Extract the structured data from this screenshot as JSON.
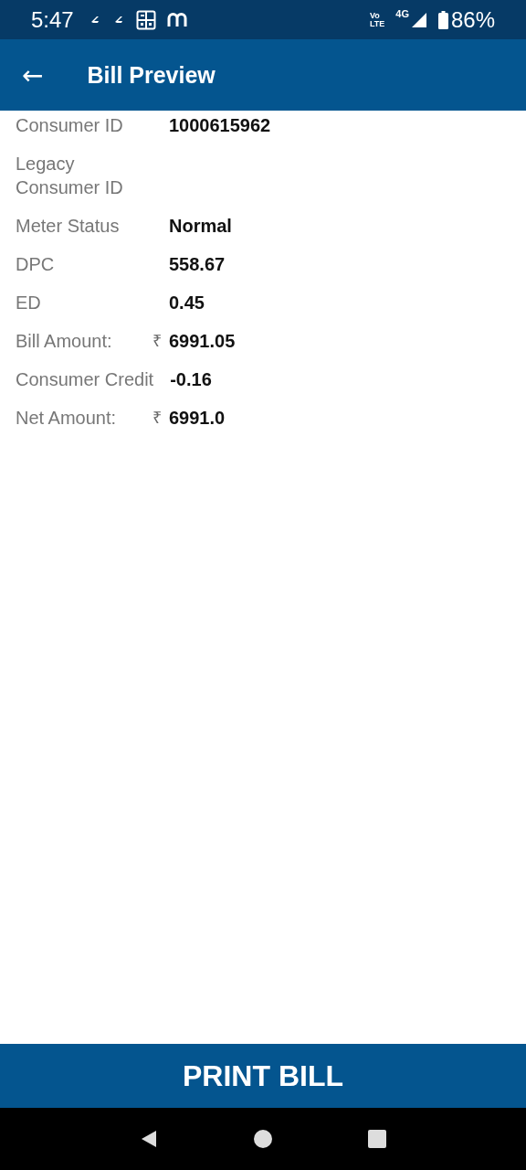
{
  "status_bar": {
    "time": "5:47",
    "network_top": "Vo",
    "network_bottom": "LTE",
    "network_type": "4G",
    "battery": "86%"
  },
  "app_bar": {
    "back": "←",
    "title": "Bill Preview"
  },
  "fields": [
    {
      "label": "Consumer ID",
      "value": "1000615962"
    },
    {
      "label": "Legacy Consumer ID"
    },
    {
      "label": "Meter Status",
      "value": "Normal"
    },
    {
      "label": "DPC",
      "value": "558.67"
    },
    {
      "label": "ED",
      "value": "0.45"
    },
    {
      "label": "Bill Amount:",
      "currency": "₹",
      "value": "6991.05"
    },
    {
      "label": "Consumer Credit",
      "value": "-0.16"
    },
    {
      "label": "Net Amount:",
      "currency": "₹",
      "value": "6991.0"
    }
  ],
  "print_button": "PRINT BILL"
}
